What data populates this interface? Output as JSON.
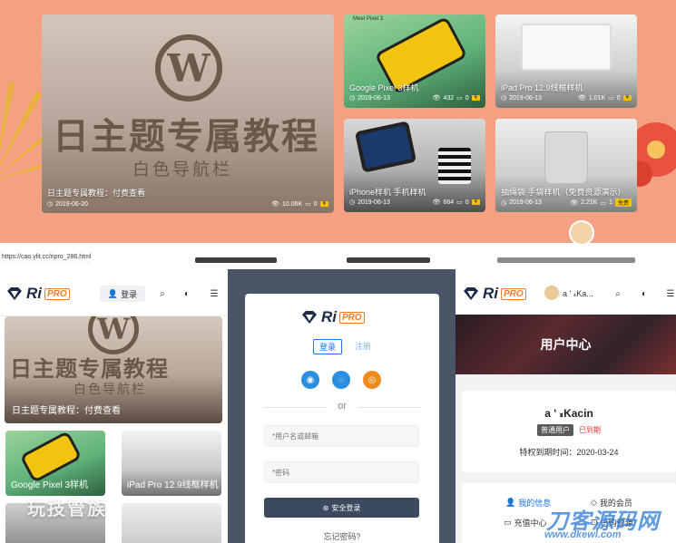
{
  "banner": {
    "main_card": {
      "hero_line1": "日主题专属教程",
      "hero_line2": "白色导航栏",
      "caption": "日主题专属教程：付费查看",
      "date": "2019-06-20",
      "views": "10.06K",
      "comments": "0"
    },
    "cards": [
      {
        "tag": "Meet Pixel 3.",
        "caption": "Google Pixel 3样机",
        "date": "2019-06-13",
        "views": "432",
        "comments": "0"
      },
      {
        "caption": "iPad Pro 12.9线框样机",
        "date": "2019-06-13",
        "views": "1.01K",
        "comments": "0"
      },
      {
        "caption": "iPhone样机 手机样机",
        "date": "2019-06-13",
        "views": "664",
        "comments": "0"
      },
      {
        "caption": "抽绳袋 手袋样机（免费资源演示）",
        "date": "2019-06-13",
        "views": "2.21K",
        "comments": "1",
        "badge": "免费"
      }
    ]
  },
  "status_url": "https://cao.ylit.cc/ripro_286.html",
  "logo": {
    "ri": "Ri",
    "pro": "PRO"
  },
  "left": {
    "login_label": "登录",
    "hero_line1": "日主题专属教程",
    "hero_line2": "白色导航栏",
    "hero_caption": "日主题专属教程：付费查看",
    "cards": [
      "Google Pixel 3样机",
      "iPad Pro 12.9线框样机"
    ],
    "watermark": "玩技管族"
  },
  "login_modal": {
    "tab_login": "登录",
    "tab_register": "注册",
    "or": "or",
    "username_placeholder": "*用户名或邮箱",
    "password_placeholder": "*密码",
    "submit": "安全登录",
    "forgot": "忘记密码?"
  },
  "right": {
    "header_user": "a ' ៵Ka...",
    "banner_title": "用户中心",
    "username": "a ' ៵Kacin",
    "badge_member": "普通用户",
    "badge_expired": "已到期",
    "expiry": "特权到期时间：2020-03-24",
    "menu": [
      {
        "label": "我的信息",
        "icon": "user-icon",
        "active": true
      },
      {
        "label": "我的会员",
        "icon": "diamond-icon",
        "active": false
      },
      {
        "label": "充值中心",
        "icon": "card-icon",
        "active": false
      },
      {
        "label": "已购资源",
        "icon": "cart-icon",
        "active": false
      }
    ],
    "watermark": "刀客源码网",
    "watermark_url": "www.dkewl.com"
  },
  "colors": {
    "banner_bg": "#f4a183",
    "accent_blue": "#1a73e8",
    "brand_orange": "#f07b2a",
    "brand_navy": "#1b2b45",
    "badge_yellow": "#f6c200"
  }
}
